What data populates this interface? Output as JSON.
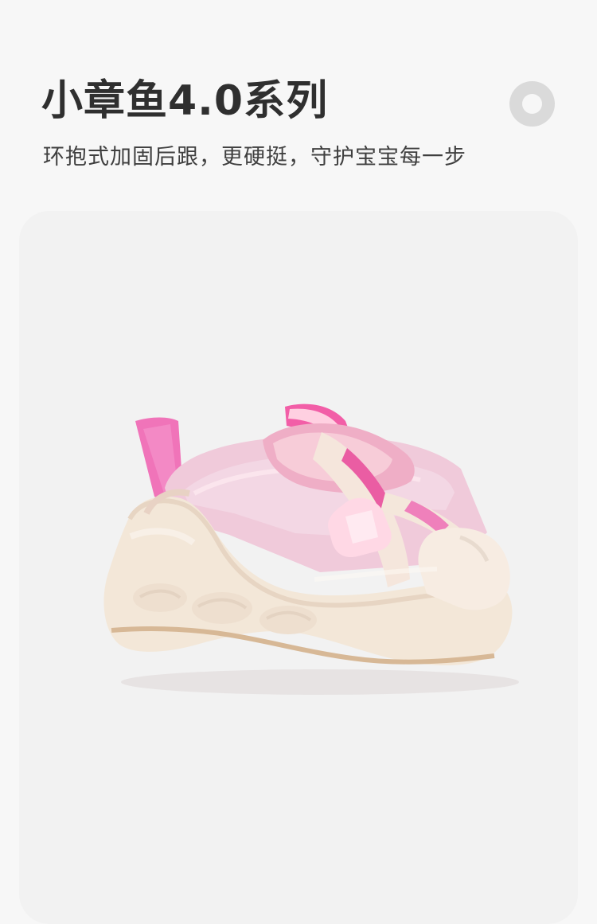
{
  "header": {
    "title": "小章鱼4.0系列",
    "subtitle": "环抱式加固后跟，更硬挺，守护宝宝每一步"
  },
  "decor": {
    "ring_icon": "ring-icon"
  },
  "product": {
    "image_icon": "pink-mesh-kids-sandal",
    "colors": {
      "pink_strap": "#ee79b6",
      "mesh_pink": "#f2c8d9",
      "sole_beige": "#f2e6d7",
      "card_bg": "#f2f2f2"
    }
  }
}
